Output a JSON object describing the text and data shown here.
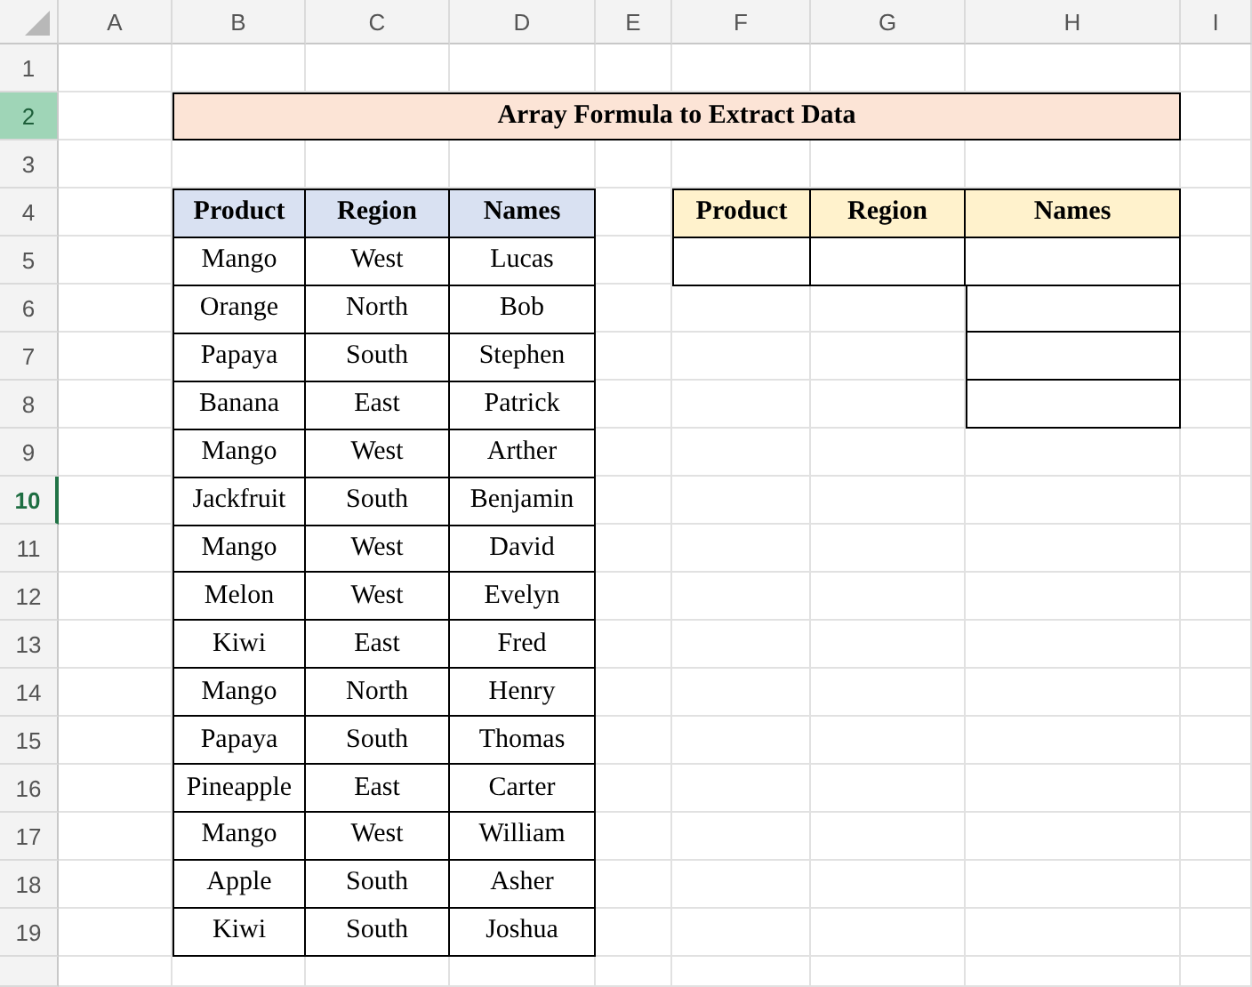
{
  "column_headers": [
    {
      "label": "A",
      "selected": false
    },
    {
      "label": "B",
      "selected": false
    },
    {
      "label": "C",
      "selected": false
    },
    {
      "label": "D",
      "selected": false
    },
    {
      "label": "E",
      "selected": false
    },
    {
      "label": "F",
      "selected": false
    },
    {
      "label": "G",
      "selected": false
    },
    {
      "label": "H",
      "selected": false
    },
    {
      "label": "I",
      "selected": false
    }
  ],
  "row_headers": [
    {
      "label": "1",
      "selected": false,
      "active": false
    },
    {
      "label": "2",
      "selected": true,
      "active": false
    },
    {
      "label": "3",
      "selected": false,
      "active": false
    },
    {
      "label": "4",
      "selected": false,
      "active": false
    },
    {
      "label": "5",
      "selected": false,
      "active": false
    },
    {
      "label": "6",
      "selected": false,
      "active": false
    },
    {
      "label": "7",
      "selected": false,
      "active": false
    },
    {
      "label": "8",
      "selected": false,
      "active": false
    },
    {
      "label": "9",
      "selected": false,
      "active": false
    },
    {
      "label": "10",
      "selected": false,
      "active": true
    },
    {
      "label": "11",
      "selected": false,
      "active": false
    },
    {
      "label": "12",
      "selected": false,
      "active": false
    },
    {
      "label": "13",
      "selected": false,
      "active": false
    },
    {
      "label": "14",
      "selected": false,
      "active": false
    },
    {
      "label": "15",
      "selected": false,
      "active": false
    },
    {
      "label": "16",
      "selected": false,
      "active": false
    },
    {
      "label": "17",
      "selected": false,
      "active": false
    },
    {
      "label": "18",
      "selected": false,
      "active": false
    },
    {
      "label": "19",
      "selected": false,
      "active": false
    }
  ],
  "title": "Array Formula to Extract Data",
  "source_table": {
    "columns": [
      "Product",
      "Region",
      "Names"
    ],
    "rows": [
      [
        "Mango",
        "West",
        "Lucas"
      ],
      [
        "Orange",
        "North",
        "Bob"
      ],
      [
        "Papaya",
        "South",
        "Stephen"
      ],
      [
        "Banana",
        "East",
        "Patrick"
      ],
      [
        "Mango",
        "West",
        "Arther"
      ],
      [
        "Jackfruit",
        "South",
        "Benjamin"
      ],
      [
        "Mango",
        "West",
        "David"
      ],
      [
        "Melon",
        "West",
        "Evelyn"
      ],
      [
        "Kiwi",
        "East",
        "Fred"
      ],
      [
        "Mango",
        "North",
        "Henry"
      ],
      [
        "Papaya",
        "South",
        "Thomas"
      ],
      [
        "Pineapple",
        "East",
        "Carter"
      ],
      [
        "Mango",
        "West",
        "William"
      ],
      [
        "Apple",
        "South",
        "Asher"
      ],
      [
        "Kiwi",
        "South",
        "Joshua"
      ]
    ]
  },
  "result_table": {
    "columns": [
      "Product",
      "Region",
      "Names"
    ],
    "rows": [
      {
        "kind": "full"
      },
      {
        "kind": "names_only"
      },
      {
        "kind": "names_only"
      },
      {
        "kind": "names_only"
      }
    ]
  }
}
